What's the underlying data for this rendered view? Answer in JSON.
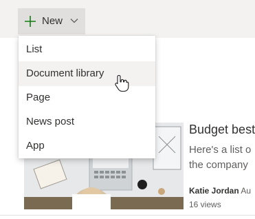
{
  "toolbar": {
    "new_label": "New",
    "new_icon": "plus-icon",
    "dropdown_icon": "chevron-down-icon",
    "accent": "#107c10"
  },
  "menu": {
    "items": [
      {
        "label": "List"
      },
      {
        "label": "Document library",
        "hovered": true
      },
      {
        "label": "Page"
      },
      {
        "label": "News post"
      },
      {
        "label": "App"
      }
    ]
  },
  "article": {
    "title": "Budget best",
    "description_line1": "Here's a list o",
    "description_line2": "the company",
    "author": "Katie Jordan",
    "author_suffix": " Au",
    "views": "16 views"
  }
}
